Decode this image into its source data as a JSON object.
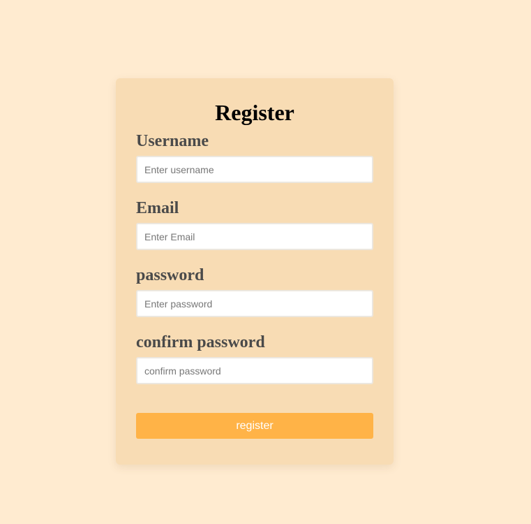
{
  "form": {
    "title": "Register",
    "fields": [
      {
        "label": "Username",
        "placeholder": "Enter username",
        "value": ""
      },
      {
        "label": "Email",
        "placeholder": "Enter Email",
        "value": ""
      },
      {
        "label": "password",
        "placeholder": "Enter password",
        "value": ""
      },
      {
        "label": "confirm password",
        "placeholder": "confirm password",
        "value": ""
      }
    ],
    "submit_label": "register"
  },
  "colors": {
    "page_background": "#ffebd0",
    "card_background": "#f8dcb4",
    "button_background": "#ffb347",
    "label_text": "#4a4a4a"
  }
}
